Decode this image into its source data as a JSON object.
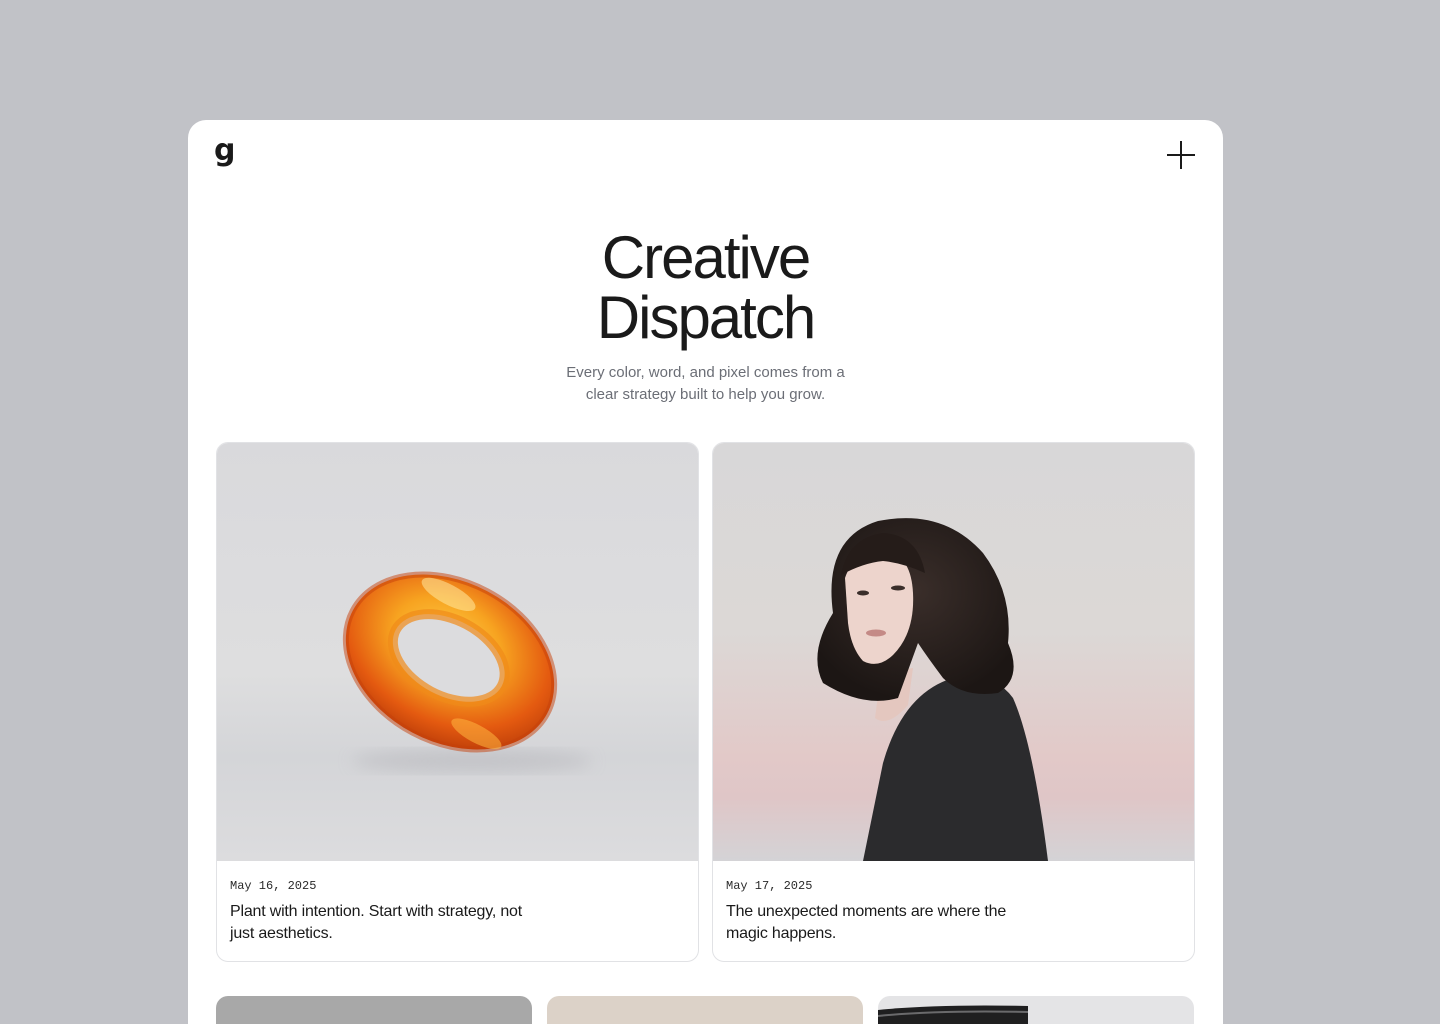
{
  "header": {
    "logo_text": "g",
    "menu_icon": "plus-icon"
  },
  "hero": {
    "title_line1": "Creative",
    "title_line2": "Dispatch",
    "subtitle": "Every color, word, and pixel comes from a clear strategy built to help you grow."
  },
  "posts": [
    {
      "date": "May 16, 2025",
      "title": "Plant with intention. Start with strategy, not just aesthetics.",
      "image": "orange-glass-ring"
    },
    {
      "date": "May 17, 2025",
      "title": "The unexpected moments are where the magic happens.",
      "image": "woman-portrait"
    }
  ],
  "colors": {
    "page_background": "#c1c2c7",
    "card_background": "#ffffff",
    "text_primary": "#1a1a1a",
    "text_secondary": "#6b6e76"
  }
}
